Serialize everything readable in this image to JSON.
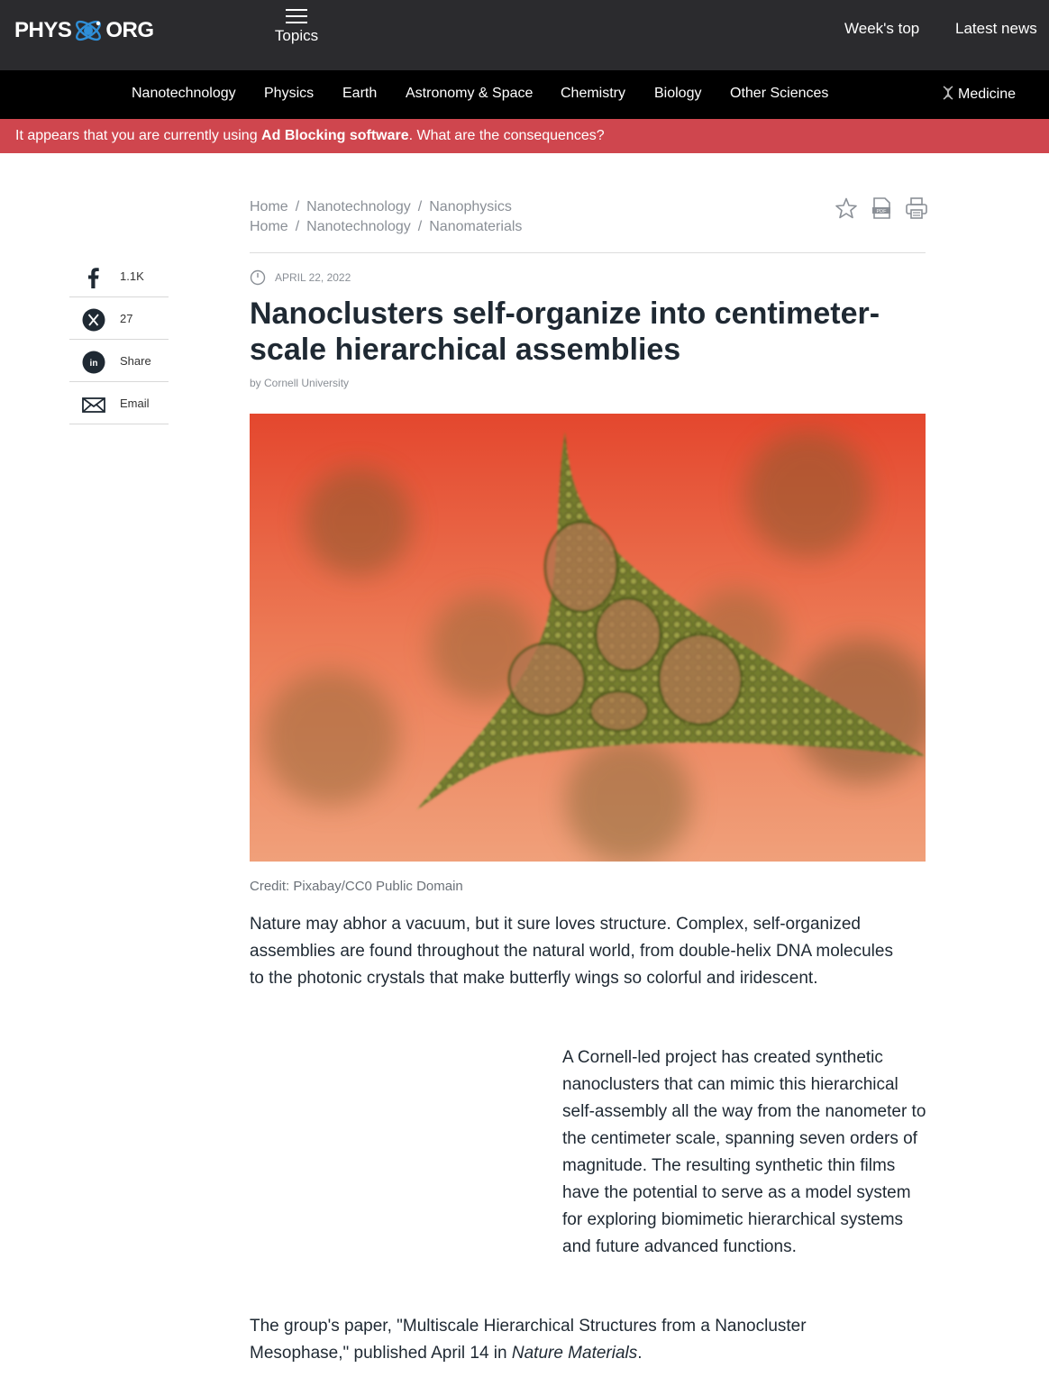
{
  "header": {
    "logo_left": "PHYS",
    "logo_right": "ORG",
    "topics_label": "Topics",
    "weeks_top": "Week's top",
    "latest_news": "Latest news"
  },
  "nav": {
    "items": [
      "Nanotechnology",
      "Physics",
      "Earth",
      "Astronomy & Space",
      "Chemistry",
      "Biology",
      "Other Sciences",
      "Medicine"
    ]
  },
  "adblock": {
    "prefix": "It appears that you are currently using ",
    "bold": "Ad Blocking software",
    "suffix": ". What are the consequences?"
  },
  "breadcrumbs": [
    [
      "Home",
      "Nanotechnology",
      "Nanophysics"
    ],
    [
      "Home",
      "Nanotechnology",
      "Nanomaterials"
    ]
  ],
  "article": {
    "date": "APRIL 22, 2022",
    "title": "Nanoclusters self-organize into centimeter-scale hierarchical assemblies",
    "byline": "by Cornell University",
    "credit": "Credit: Pixabay/CC0 Public Domain",
    "para1": "Nature may abhor a vacuum, but it sure loves structure. Complex, self-organized assemblies are found throughout the natural world, from double-helix DNA molecules to the photonic crystals that make butterfly wings so colorful and iridescent.",
    "para2": "A Cornell-led project has created synthetic nanoclusters that can mimic this hierarchical self-assembly all the way from the nanometer to the centimeter scale, spanning seven orders of magnitude. The resulting synthetic thin films have the potential to serve as a model system for exploring biomimetic hierarchical systems and future advanced functions.",
    "para3_prefix": "The group's paper, \"Multiscale Hierarchical Structures from a Nanocluster Mesophase,\" published April 14 in ",
    "para3_journal": "Nature Materials",
    "para3_suffix": "."
  },
  "share": {
    "facebook_count": "1.1K",
    "x_count": "27",
    "linkedin_label": "Share",
    "email_label": "Email"
  },
  "colors": {
    "topbar": "#2b2b2e",
    "navbar": "#000000",
    "adbar": "#cf464e",
    "logo_accent": "#2f8fd8"
  }
}
